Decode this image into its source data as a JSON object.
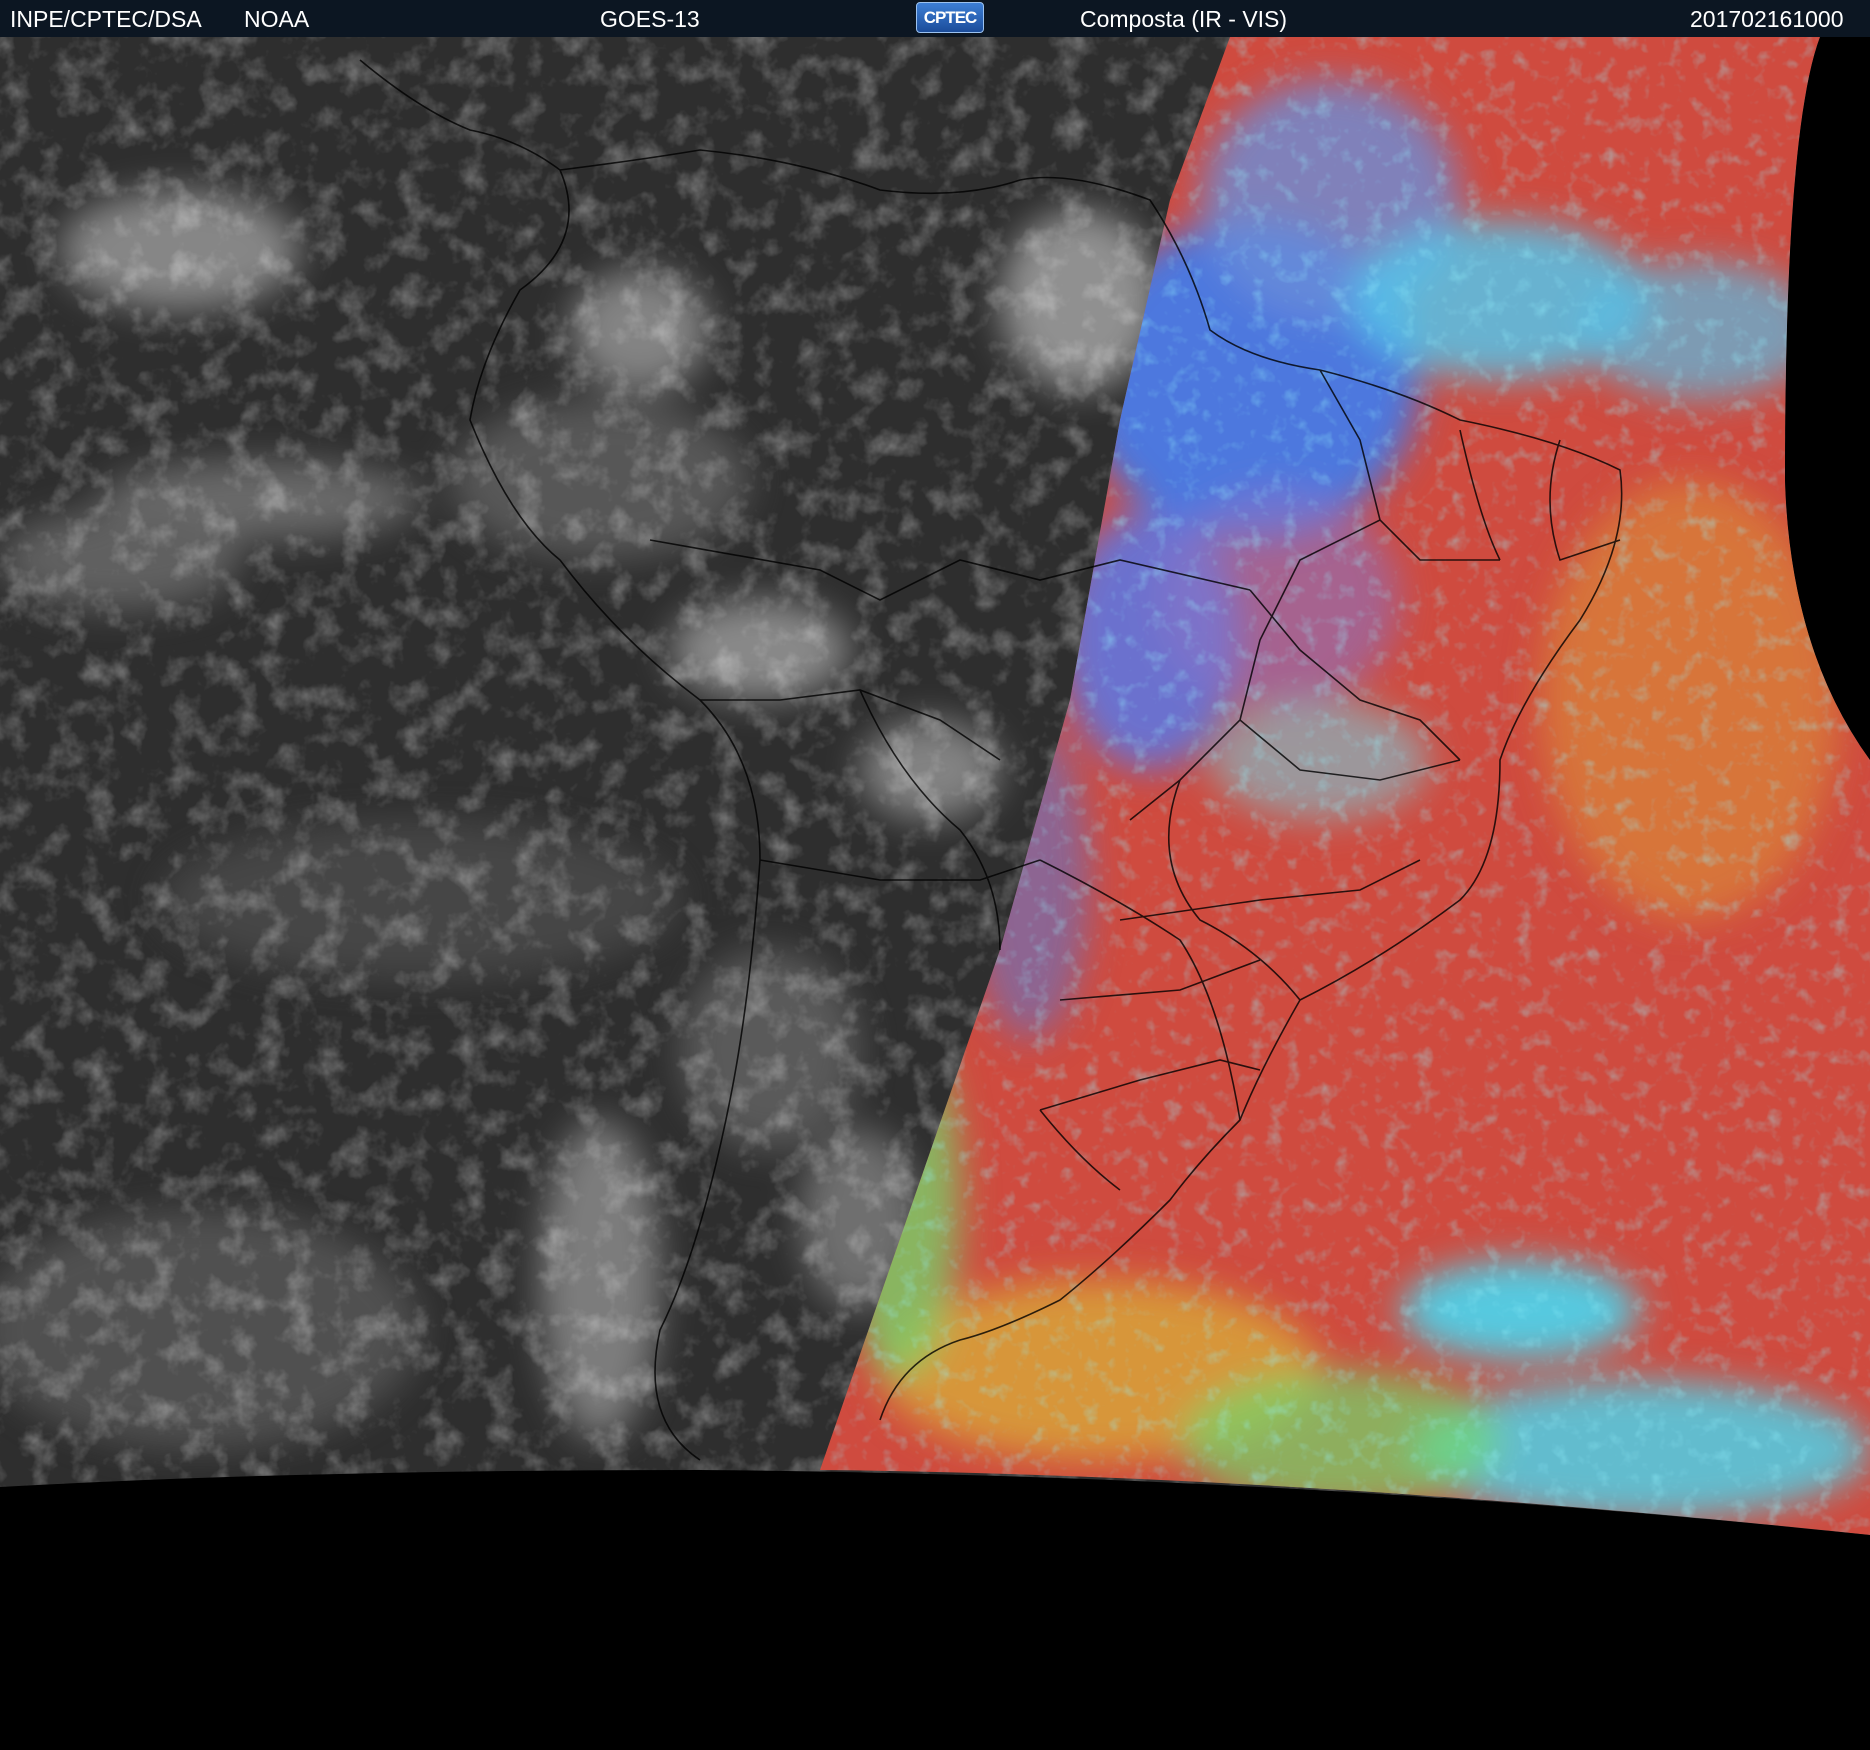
{
  "header": {
    "agency": "INPE/CPTEC/DSA",
    "source": "NOAA",
    "satellite": "GOES-13",
    "logo_text": "CPTEC",
    "product": "Composta (IR - VIS)",
    "timestamp": "201702161000"
  },
  "colors": {
    "header_bg": "#0c1622",
    "space": "#000000",
    "ir_dark": "#2b2b2b",
    "ir_cloud": "#d8d8d8",
    "vis_red": "#cf4b3f",
    "vis_orange": "#d9833a",
    "vis_cyan": "#4fd0e8",
    "vis_blue": "#3f7df0",
    "vis_green": "#72d86c",
    "borders": "#000000"
  }
}
